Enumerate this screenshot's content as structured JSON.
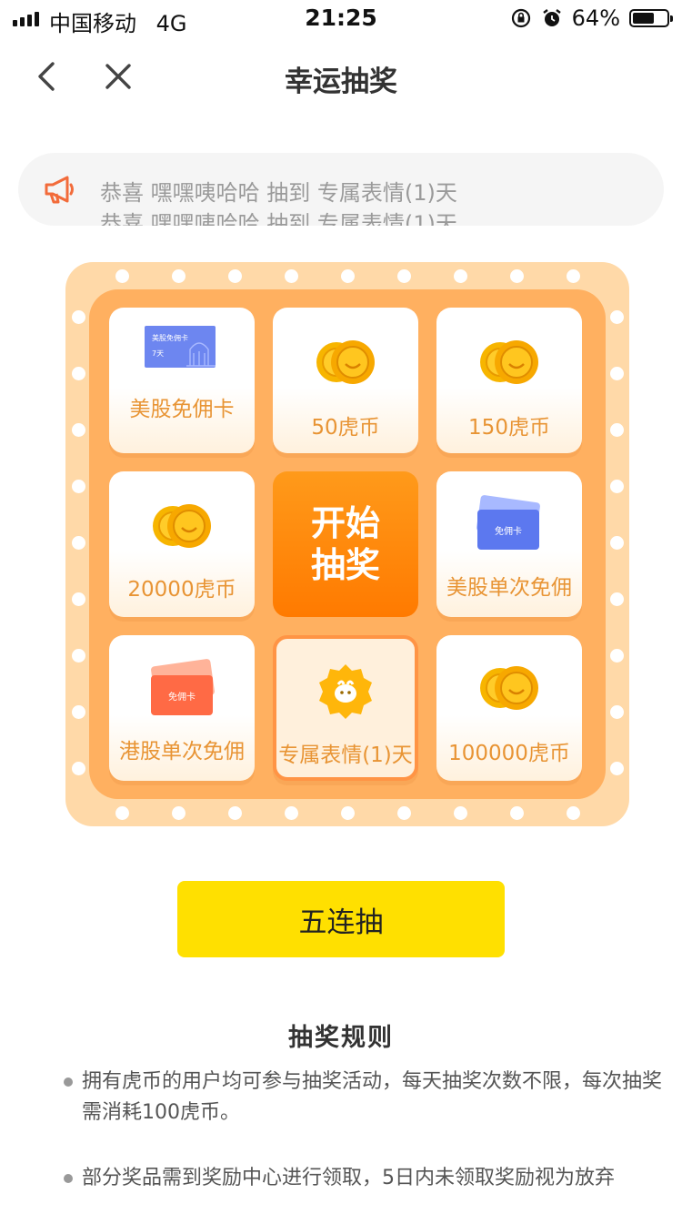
{
  "status_bar": {
    "carrier": "中国移动",
    "network": "4G",
    "time": "21:25",
    "battery": "64%",
    "battery_level": 0.64
  },
  "nav": {
    "title": "幸运抽奖"
  },
  "notice": {
    "lines": [
      "恭喜 嘿嘿咦哈哈 抽到 专属表情(1)天",
      "恭喜 嘿嘿咦哈哈 抽到 专属表情(1)天"
    ]
  },
  "prizes": {
    "p1": {
      "label": "美股免佣卡",
      "icon": "us-stock-commission-card",
      "card_line1": "美股免佣卡",
      "card_line2": "7天"
    },
    "p2": {
      "label": "50虎币",
      "icon": "coins-icon"
    },
    "p3": {
      "label": "150虎币",
      "icon": "coins-icon"
    },
    "p4": {
      "label": "20000虎币",
      "icon": "coins-icon"
    },
    "p5": {
      "label": "美股单次免佣",
      "icon": "blue-card",
      "card_text": "免佣卡"
    },
    "p6": {
      "label": "港股单次免佣",
      "icon": "orange-card",
      "card_text": "免佣卡"
    },
    "p7": {
      "label": "专属表情(1)天",
      "icon": "emoji-badge"
    },
    "p8": {
      "label": "100000虎币",
      "icon": "coins-icon"
    }
  },
  "start": {
    "line1": "开始",
    "line2": "抽奖"
  },
  "five_draw": {
    "label": "五连抽"
  },
  "rules": {
    "title": "抽奖规则",
    "items": [
      "拥有虎币的用户均可参与抽奖活动，每天抽奖次数不限，每次抽奖需消耗100虎币。",
      "部分奖品需到奖励中心进行领取，5日内未领取奖励视为放弃"
    ]
  },
  "colors": {
    "board_outer": "#ffd9a8",
    "board_inner": "#ffb060",
    "start": "#ff8a00",
    "label": "#e89434",
    "five_draw": "#ffe000",
    "active_border": "#ff9445"
  }
}
